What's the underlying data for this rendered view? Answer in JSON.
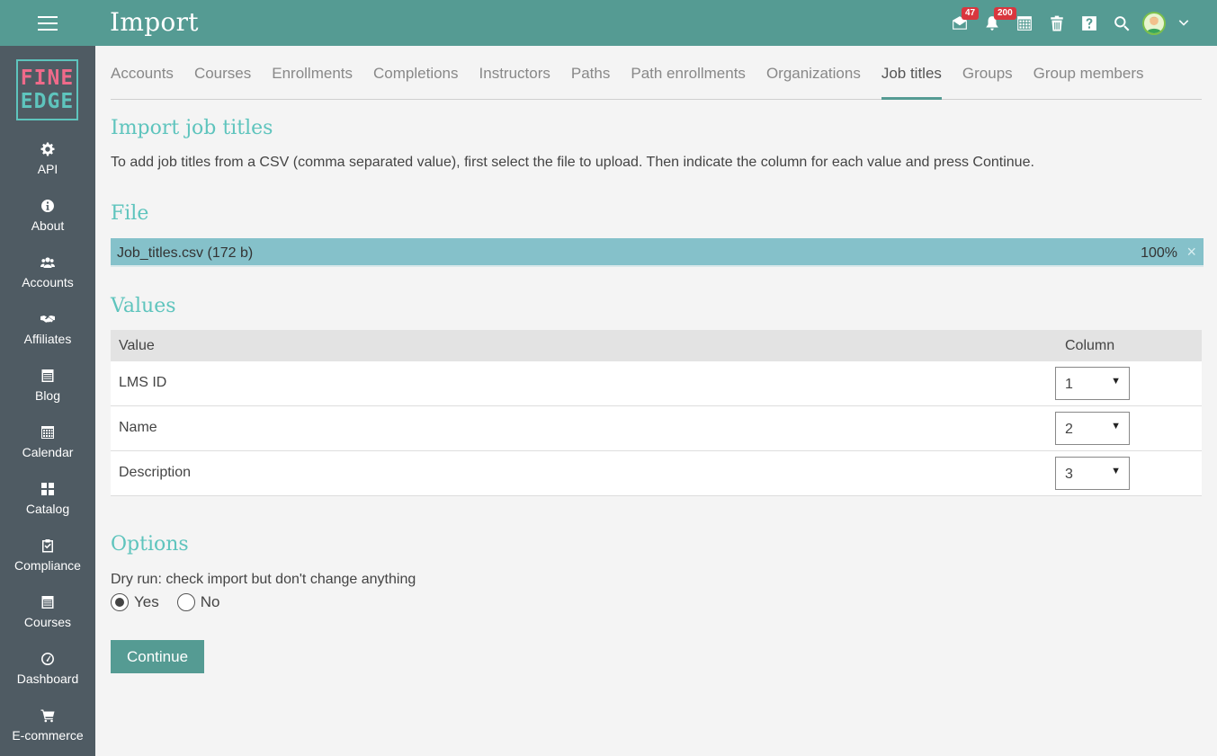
{
  "header": {
    "title": "Import",
    "messages_badge": "47",
    "notifications_badge": "200"
  },
  "logo": {
    "line1": "FINE",
    "line2": "EDGE"
  },
  "sidebar": {
    "items": [
      {
        "label": "API",
        "icon": "gear-icon"
      },
      {
        "label": "About",
        "icon": "info-icon"
      },
      {
        "label": "Accounts",
        "icon": "users-icon"
      },
      {
        "label": "Affiliates",
        "icon": "handshake-icon"
      },
      {
        "label": "Blog",
        "icon": "blog-icon"
      },
      {
        "label": "Calendar",
        "icon": "calendar-icon"
      },
      {
        "label": "Catalog",
        "icon": "catalog-icon"
      },
      {
        "label": "Compliance",
        "icon": "clipboard-check-icon"
      },
      {
        "label": "Courses",
        "icon": "courses-icon"
      },
      {
        "label": "Dashboard",
        "icon": "dashboard-icon"
      },
      {
        "label": "E-commerce",
        "icon": "cart-icon"
      }
    ]
  },
  "tabs": [
    {
      "label": "Accounts"
    },
    {
      "label": "Courses"
    },
    {
      "label": "Enrollments"
    },
    {
      "label": "Completions"
    },
    {
      "label": "Instructors"
    },
    {
      "label": "Paths"
    },
    {
      "label": "Path enrollments"
    },
    {
      "label": "Organizations"
    },
    {
      "label": "Job titles",
      "active": true
    },
    {
      "label": "Groups"
    },
    {
      "label": "Group members"
    }
  ],
  "main": {
    "heading": "Import job titles",
    "intro": "To add job titles from a CSV (comma separated value), first select the file to upload. Then indicate the column for each value and press Continue.",
    "file_heading": "File",
    "file": {
      "name": "Job_titles.csv (172 b)",
      "progress": "100%",
      "close": "×"
    },
    "values_heading": "Values",
    "table": {
      "col_value": "Value",
      "col_column": "Column",
      "rows": [
        {
          "label": "LMS ID",
          "column": "1"
        },
        {
          "label": "Name",
          "column": "2"
        },
        {
          "label": "Description",
          "column": "3"
        }
      ]
    },
    "options_heading": "Options",
    "dry_run_label": "Dry run: check import but don't change anything",
    "dry_run_yes": "Yes",
    "dry_run_no": "No",
    "dry_run_selected": "Yes",
    "continue_label": "Continue"
  },
  "colors": {
    "header": "#559b93",
    "sidebar": "#4f5b63",
    "accent": "#5ec4bd",
    "file_bar": "#85c1ca",
    "badge": "#d9363e"
  }
}
